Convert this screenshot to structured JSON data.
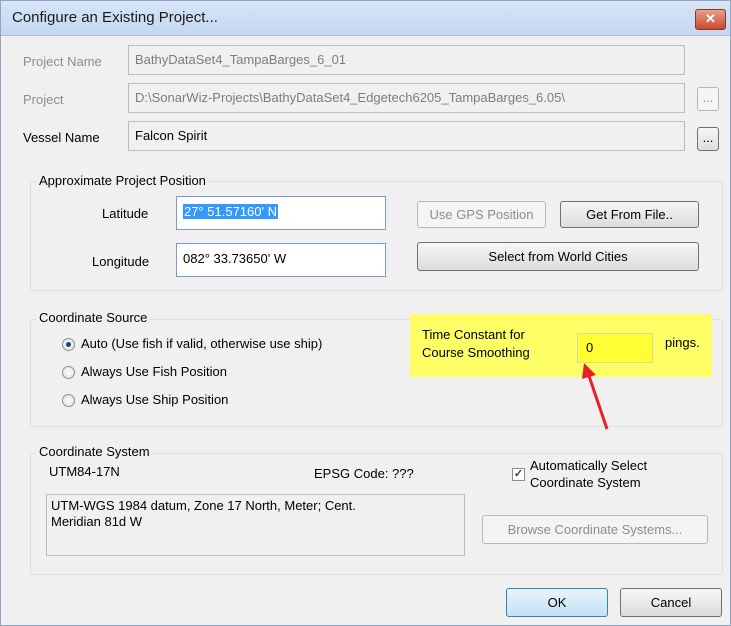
{
  "window": {
    "title": "Configure an Existing Project...",
    "close_glyph": "✕"
  },
  "project": {
    "name_label": "Project Name",
    "name_value": "BathyDataSet4_TampaBarges_6_01",
    "path_label": "Project",
    "path_value": "D:\\SonarWiz-Projects\\BathyDataSet4_Edgetech6205_TampaBarges_6.05\\",
    "browse_label": "...",
    "vessel_label": "Vessel Name",
    "vessel_value": "Falcon Spirit",
    "vessel_browse_label": "..."
  },
  "position": {
    "group_title": "Approximate Project Position",
    "latitude_label": "Latitude",
    "latitude_value": "27° 51.57160' N",
    "longitude_label": "Longitude",
    "longitude_value": "082° 33.73650' W",
    "use_gps_label": "Use GPS Position",
    "get_from_file_label": "Get From File..",
    "world_cities_label": "Select from World Cities"
  },
  "coord_source": {
    "group_title": "Coordinate Source",
    "options": [
      {
        "label": "Auto (Use fish if valid, otherwise use ship)",
        "checked": true
      },
      {
        "label": "Always Use Fish Position",
        "checked": false
      },
      {
        "label": "Always Use Ship Position",
        "checked": false
      }
    ],
    "time_constant_line1": "Time Constant for",
    "time_constant_line2": "Course Smoothing",
    "time_constant_value": "0",
    "pings_label": "pings."
  },
  "coord_system": {
    "group_title": "Coordinate System",
    "zone": "UTM84-17N",
    "epsg": "EPSG Code: ???",
    "auto_select_line1": "Automatically Select",
    "auto_select_line2": "Coordinate System",
    "auto_select_checked": true,
    "description_line1": "UTM-WGS 1984 datum, Zone 17 North, Meter; Cent.",
    "description_line2": "Meridian 81d W",
    "browse_label": "Browse Coordinate Systems..."
  },
  "footer": {
    "ok_label": "OK",
    "cancel_label": "Cancel"
  },
  "colors": {
    "annotation_arrow": "#e8202a",
    "highlight": "#ffff66",
    "selection": "#3399ff"
  }
}
